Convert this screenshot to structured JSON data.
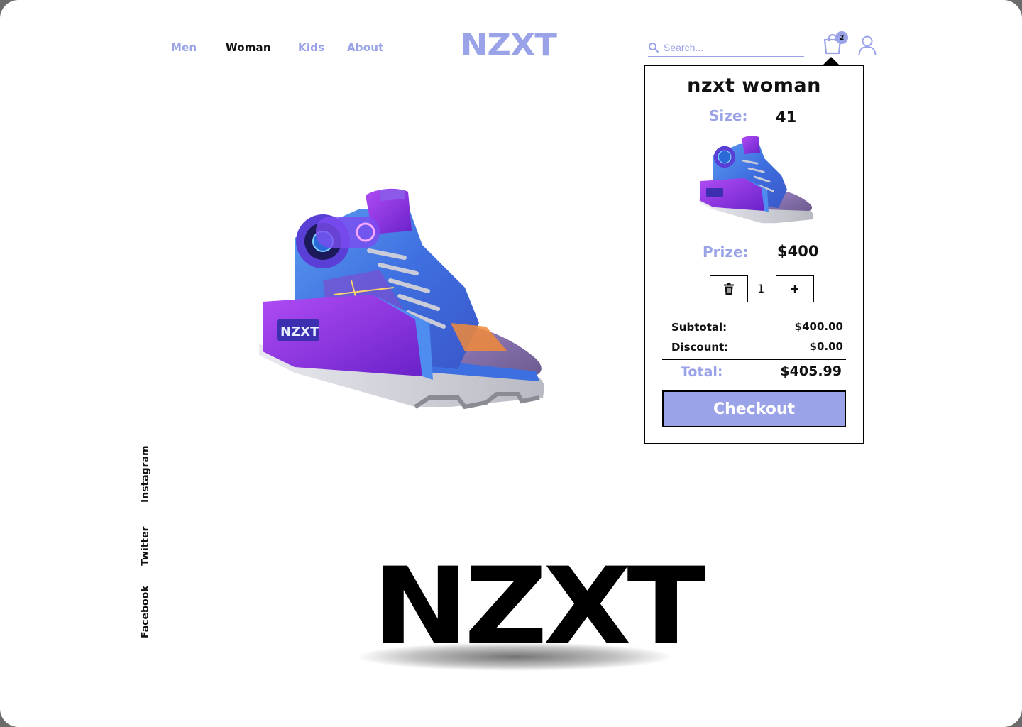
{
  "nav": {
    "links": [
      {
        "label": "Men",
        "active": false
      },
      {
        "label": "Woman",
        "active": true
      },
      {
        "label": "Kids",
        "active": false
      },
      {
        "label": "About",
        "active": false
      }
    ],
    "logo": "NZXT"
  },
  "search": {
    "placeholder": "Search..."
  },
  "cart": {
    "count": "2"
  },
  "hero": {
    "brand_text": "NZXT"
  },
  "socials": [
    "Instagram",
    "Twitter",
    "Facebook"
  ],
  "footer_logo": "NZXT",
  "cart_popup": {
    "title": "nzxt woman",
    "size_label": "Size:",
    "size_value": "41",
    "price_label": "Prize:",
    "price_value": "$400",
    "quantity": "1",
    "subtotal_label": "Subtotal:",
    "subtotal_value": "$400.00",
    "discount_label": "Discount:",
    "discount_value": "$0.00",
    "total_label": "Total:",
    "total_value": "$405.99",
    "checkout_label": "Checkout"
  },
  "colors": {
    "accent": "#9aa3e8",
    "text": "#111111",
    "background": "#ffffff"
  },
  "icons": {
    "search": "search-icon",
    "cart": "shopping-bag-icon",
    "user": "user-icon",
    "delete": "trash-icon",
    "add": "plus-icon"
  }
}
